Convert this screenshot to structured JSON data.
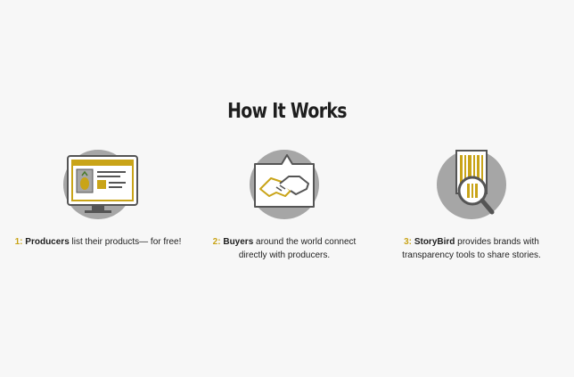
{
  "section": {
    "title": "How It Works"
  },
  "colors": {
    "accent": "#c9a418",
    "gray": "#a6a6a6",
    "dark": "#555555",
    "background": "#f7f7f7"
  },
  "steps": [
    {
      "icon": "monitor-icon",
      "number": "1:",
      "keyword": "Producers",
      "text": "list their products— for free!"
    },
    {
      "icon": "handshake-icon",
      "number": "2:",
      "keyword": "Buyers",
      "text": "around the world connect directly with producers."
    },
    {
      "icon": "barcode-magnifier-icon",
      "number": "3:",
      "keyword": "StoryBird",
      "text": "provides brands with transparency tools to share stories."
    }
  ]
}
